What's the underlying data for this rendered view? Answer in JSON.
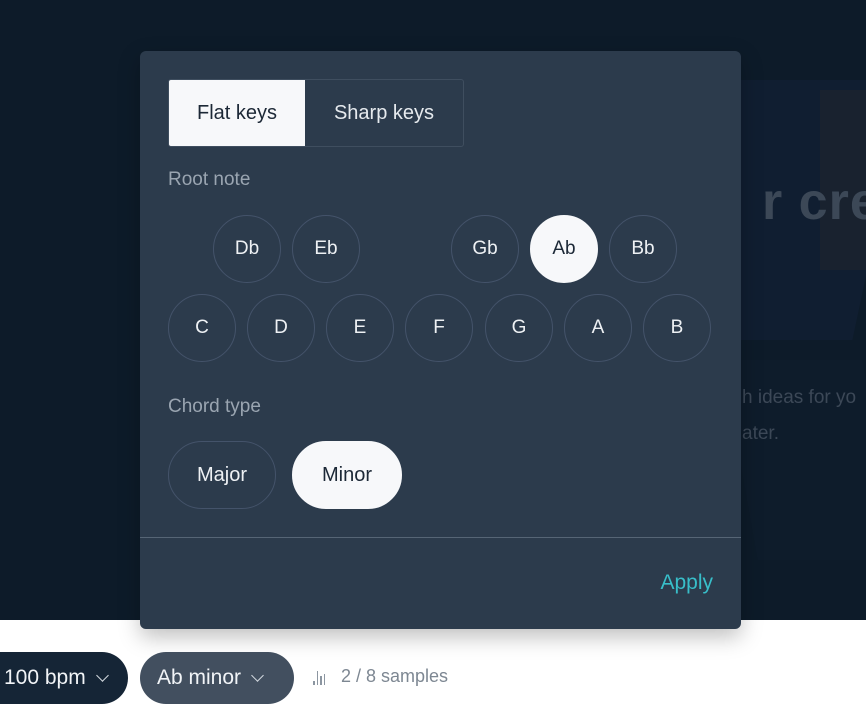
{
  "background": {
    "title_fragment": "r cre",
    "subtitle_lines": [
      "h ideas for yo",
      "ater."
    ]
  },
  "key_picker": {
    "tabs": [
      {
        "label": "Flat keys",
        "active": true
      },
      {
        "label": "Sharp keys",
        "active": false
      }
    ],
    "root_note_label": "Root note",
    "accidental_notes": [
      "Db",
      "Eb",
      "Gb",
      "Ab",
      "Bb"
    ],
    "natural_notes": [
      "C",
      "D",
      "E",
      "F",
      "G",
      "A",
      "B"
    ],
    "selected_root": "Ab",
    "chord_type_label": "Chord type",
    "chord_types": [
      "Major",
      "Minor"
    ],
    "selected_chord_type": "Minor",
    "apply_label": "Apply",
    "accent_color": "#38bec9"
  },
  "toolbar": {
    "tempo_label": "100 bpm",
    "key_label": "Ab minor",
    "samples_icon": "bar-chart-icon",
    "samples_text": "2 / 8 samples"
  }
}
